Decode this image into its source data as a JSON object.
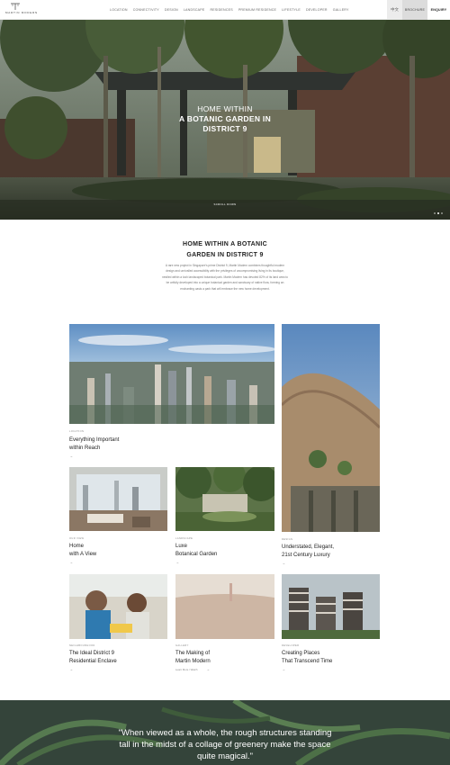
{
  "header": {
    "logo_text": "MARTIN MODERN",
    "nav": [
      "LOCATION",
      "CONNECTIVITY",
      "DESIGN",
      "LANDSCAPE",
      "RESIDENCES",
      "PREMIUM RESIDENCE",
      "LIFESTYLE",
      "DEVELOPER",
      "GALLERY"
    ],
    "lang": "中文",
    "brochure": "BROCHURE",
    "enquiry": "ENQUIRY"
  },
  "hero": {
    "title_line1": "HOME WITHIN",
    "title_line2": "A BOTANIC GARDEN IN",
    "title_line3": "DISTRICT 9",
    "scroll_label": "SCROLL DOWN",
    "slides_total": 3,
    "slide_active": 2
  },
  "intro": {
    "title_line1": "HOME WITHIN A BOTANIC",
    "title_line2": "GARDEN IN DISTRICT 9",
    "body": "A rare new project in Singapore's prime District 9, Martin Modern combines thoughtful modern design and unrivalled accessibility with the privileges of uncompromising living in its boutique, nestled within a lush landscaped botanical park. Martin Modern has devoted 82% of its land area to be artfully developed into a unique botanical garden and sanctuary of native flora, forming an enchanting oasis a park that will embrace the new home development."
  },
  "cards": [
    {
      "category": "LOCATION",
      "title1": "Everything Important",
      "title2": "within Reach",
      "sub": "",
      "arrow": "→"
    },
    {
      "category": "DESIGN",
      "title1": "Understated, Elegant,",
      "title2": "21st Century Luxury",
      "sub": "",
      "arrow": "→"
    },
    {
      "category": "OUR VIEW",
      "title1": "Home",
      "title2": "with A View",
      "sub": "",
      "arrow": "→"
    },
    {
      "category": "LANDSCAPE",
      "title1": "Luxe",
      "title2": "Botanical Garden",
      "sub": "",
      "arrow": "→"
    },
    {
      "category": "NEIGHBOURHOOD",
      "title1": "The Ideal District 9",
      "title2": "Residential Enclave",
      "sub": "",
      "arrow": "→"
    },
    {
      "category": "GALLERY",
      "title1": "The Making of",
      "title2": "Martin Modern",
      "sub": "Learn More / Watch",
      "arrow": "→"
    },
    {
      "category": "DEVELOPER",
      "title1": "Creating Places",
      "title2": "That Transcend Time",
      "sub": "",
      "arrow": "→"
    }
  ],
  "quote": {
    "line1": "\"When viewed as a whole, the rough structures standing",
    "line2": "tall in the midst of a collage of greenery make the space",
    "line3": "quite magical.\""
  }
}
